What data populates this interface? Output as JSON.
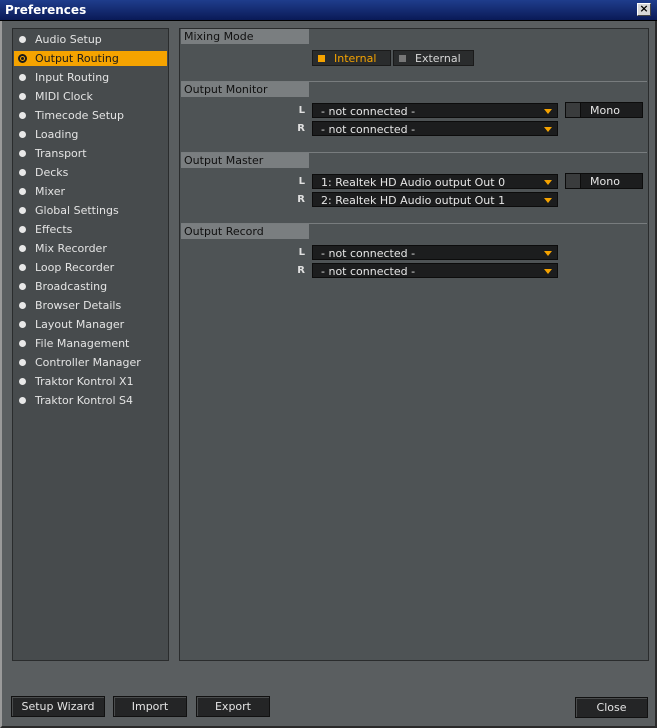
{
  "window": {
    "title": "Preferences",
    "close_glyph": "×"
  },
  "sidebar": {
    "items": [
      {
        "label": "Audio Setup"
      },
      {
        "label": "Output Routing",
        "active": true
      },
      {
        "label": "Input Routing"
      },
      {
        "label": "MIDI Clock"
      },
      {
        "label": "Timecode Setup"
      },
      {
        "label": "Loading"
      },
      {
        "label": "Transport"
      },
      {
        "label": "Decks"
      },
      {
        "label": "Mixer"
      },
      {
        "label": "Global Settings"
      },
      {
        "label": "Effects"
      },
      {
        "label": "Mix Recorder"
      },
      {
        "label": "Loop Recorder"
      },
      {
        "label": "Broadcasting"
      },
      {
        "label": "Browser Details"
      },
      {
        "label": "Layout Manager"
      },
      {
        "label": "File Management"
      },
      {
        "label": "Controller Manager"
      },
      {
        "label": "Traktor Kontrol X1"
      },
      {
        "label": "Traktor Kontrol S4"
      }
    ]
  },
  "mixing_mode": {
    "title": "Mixing Mode",
    "internal": "Internal",
    "external": "External",
    "selected": "Internal"
  },
  "output_monitor": {
    "title": "Output Monitor",
    "left_label": "L",
    "right_label": "R",
    "left_value": "- not connected -",
    "right_value": "- not connected -",
    "mono_label": "Mono"
  },
  "output_master": {
    "title": "Output Master",
    "left_label": "L",
    "right_label": "R",
    "left_value": "1: Realtek HD Audio output Out 0",
    "right_value": "2: Realtek HD Audio output Out 1",
    "mono_label": "Mono"
  },
  "output_record": {
    "title": "Output Record",
    "left_label": "L",
    "right_label": "R",
    "left_value": "- not connected -",
    "right_value": "- not connected -"
  },
  "footer": {
    "setup_wizard": "Setup Wizard",
    "import": "Import",
    "export": "Export",
    "close": "Close"
  },
  "colors": {
    "accent": "#f5a300",
    "panel": "#4e5355",
    "title_bar": "#0a246a"
  }
}
